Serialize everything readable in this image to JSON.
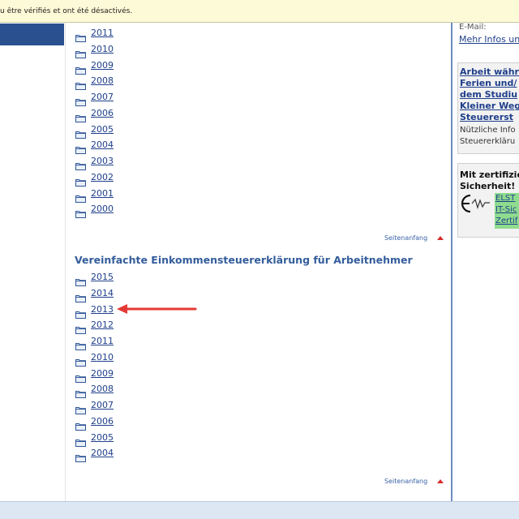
{
  "infobar": {
    "text": "u être vérifiés et ont été désactivés."
  },
  "section1": {
    "years": [
      "2011",
      "2010",
      "2009",
      "2008",
      "2007",
      "2006",
      "2005",
      "2004",
      "2003",
      "2002",
      "2001",
      "2000"
    ],
    "top_link": "Seitenanfang"
  },
  "section2": {
    "heading": "Vereinfachte Einkommensteuererklärung für Arbeitnehmer",
    "years": [
      "2015",
      "2014",
      "2013",
      "2012",
      "2011",
      "2010",
      "2009",
      "2008",
      "2007",
      "2006",
      "2005",
      "2004"
    ],
    "top_link": "Seitenanfang"
  },
  "right": {
    "email_label": "E-Mail:",
    "more_info": "Mehr Infos un",
    "article_title": [
      "Arbeit währ",
      "Ferien und/",
      "dem Studiu",
      "Kleiner Weg",
      "Steuererst"
    ],
    "article_desc": [
      "Nützliche Info",
      "Steuererkläru"
    ],
    "cert_title": [
      "Mit zertifizie",
      "Sicherheit!"
    ],
    "cert_logo_lines": [
      "ELST",
      "IT-Sic",
      "Zertif"
    ]
  },
  "annotation": {
    "color": "#e53935"
  }
}
